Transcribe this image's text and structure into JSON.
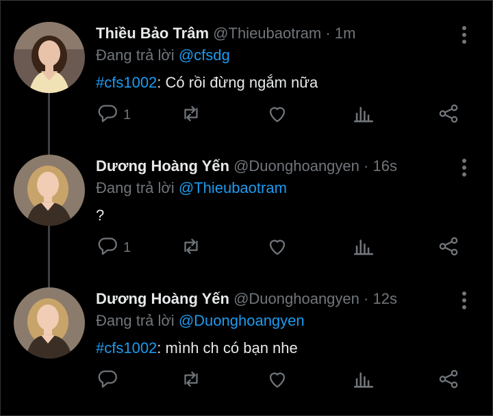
{
  "tweets": [
    {
      "name": "Thiều Bảo Trâm",
      "handle": "@Thieubaotram",
      "separator": "·",
      "time": "1m",
      "replying_prefix": "Đang trả lời",
      "replying_to": "@cfsdg",
      "hashtag": "#cfs1002",
      "text": ": Có rồi đừng ngắm nữa",
      "reply_count": "1",
      "avatar_colors": {
        "bg": "#6b5a52",
        "hair": "#3a2418",
        "skin": "#e9c3a9",
        "top": "#f1e2b5"
      }
    },
    {
      "name": "Dương Hoàng Yến",
      "handle": "@Duonghoangyen",
      "separator": "·",
      "time": "16s",
      "replying_prefix": "Đang trả lời",
      "replying_to": "@Thieubaotram",
      "hashtag": "",
      "text": "?",
      "reply_count": "1",
      "avatar_colors": {
        "bg": "#8a7b6c",
        "hair": "#c9a46a",
        "skin": "#f0cdb4",
        "top": "#3b2e24"
      }
    },
    {
      "name": "Dương Hoàng Yến",
      "handle": "@Duonghoangyen",
      "separator": "·",
      "time": "12s",
      "replying_prefix": "Đang trả lời",
      "replying_to": "@Duonghoangyen",
      "hashtag": "#cfs1002",
      "text": ": mình ch có bạn nhe",
      "reply_count": "",
      "avatar_colors": {
        "bg": "#8a7b6c",
        "hair": "#c9a46a",
        "skin": "#f0cdb4",
        "top": "#3b2e24"
      }
    }
  ],
  "icons": {
    "reply": "reply-icon",
    "retweet": "retweet-icon",
    "like": "like-icon",
    "views": "views-icon",
    "share": "share-icon",
    "more": "more-icon"
  },
  "colors": {
    "accent": "#1d9bf0",
    "muted": "#71767b",
    "text": "#e7e9ea",
    "background": "#000000"
  }
}
